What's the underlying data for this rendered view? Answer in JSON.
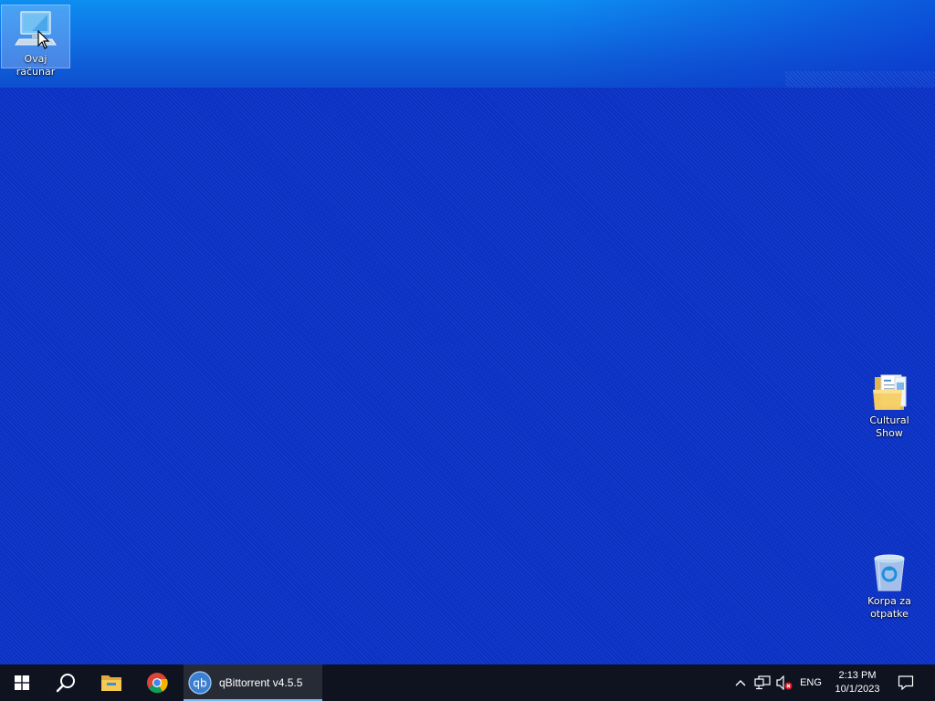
{
  "desktop": {
    "icons": [
      {
        "label": "Ovaj računar",
        "icon": "this-pc-icon"
      },
      {
        "label": "Cultural Show",
        "icon": "folder-icon"
      },
      {
        "label": "Korpa za otpatke",
        "icon": "recycle-bin-icon"
      }
    ]
  },
  "taskbar": {
    "start_icon": "windows-logo-icon",
    "search_icon": "search-icon",
    "pinned": [
      {
        "name": "File Explorer",
        "icon": "file-explorer-icon"
      },
      {
        "name": "Google Chrome",
        "icon": "chrome-icon"
      }
    ],
    "running_app": {
      "label": "qBittorrent v4.5.5",
      "icon": "qbittorrent-icon"
    },
    "tray": {
      "chevron_icon": "chevron-up-icon",
      "network_icon": "network-icon",
      "volume_icon": "volume-muted-icon",
      "language": "ENG",
      "time": "2:13 PM",
      "date": "10/1/2023",
      "notification_icon": "action-center-icon"
    }
  },
  "colors": {
    "desktop_bg": "#0a31c4",
    "taskbar_bg": "#0f1320",
    "active_underline": "#76b9ed"
  }
}
